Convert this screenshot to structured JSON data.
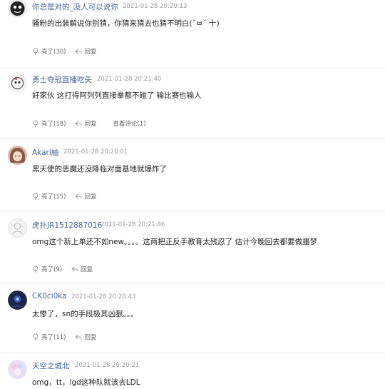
{
  "comments": [
    {
      "username": "你总是对的_没人可以说你",
      "time": "2021-01-28 20:20:13",
      "text": "骚粉的出装解说你别猜，你猜来猜去也猜不明白(ˇㅂˇ 十)",
      "like_label": "亮了(30)",
      "reply_label": "回复",
      "avatar_icon": "cartoon-face-icon"
    },
    {
      "username": "勇士夺冠直播吃矢",
      "time": "2021-01-28 20:21:40",
      "text": "好家伙 这打得阿列列直接拳都不碰了 输比赛也输人",
      "like_label": "亮了(18)",
      "reply_label": "回复",
      "view_replies_label": "查看评论(1)",
      "avatar_icon": "cartoon-face-icon"
    },
    {
      "username": "Akari紬",
      "time": "2021-01-28 20:20:01",
      "text": "黑天使的恶魔还没降临对面基地就爆炸了",
      "like_label": "亮了(15)",
      "reply_label": "回复",
      "avatar_icon": "anime-girl-icon"
    },
    {
      "username": "虎扑JR1512887016",
      "time": "2021-01-28 20:21:46",
      "text": "omg这个新上单还不如new。。。。这两把正反手教育太残忍了 估计今晚回去都要做噩梦",
      "like_label": "亮了(9)",
      "reply_label": "回复",
      "avatar_icon": "default-user-icon"
    },
    {
      "username": "CK0ci0ka",
      "time": "2021-01-28 20:20:43",
      "text": "太惨了，sn的手段极其凶狠。。。",
      "like_label": "亮了(11)",
      "reply_label": "回复",
      "avatar_icon": "dark-avatar-icon"
    },
    {
      "username": "天空之城北",
      "time": "2021-01-28 20:20:21",
      "text": "omg，tt，lgd这种队就该去LDL",
      "avatar_icon": "pastel-avatar-icon"
    }
  ],
  "colors": {
    "username": "#406599",
    "time": "#9a9a9a",
    "body_text": "#222222",
    "action_text": "#666666",
    "divider": "#ececec"
  }
}
